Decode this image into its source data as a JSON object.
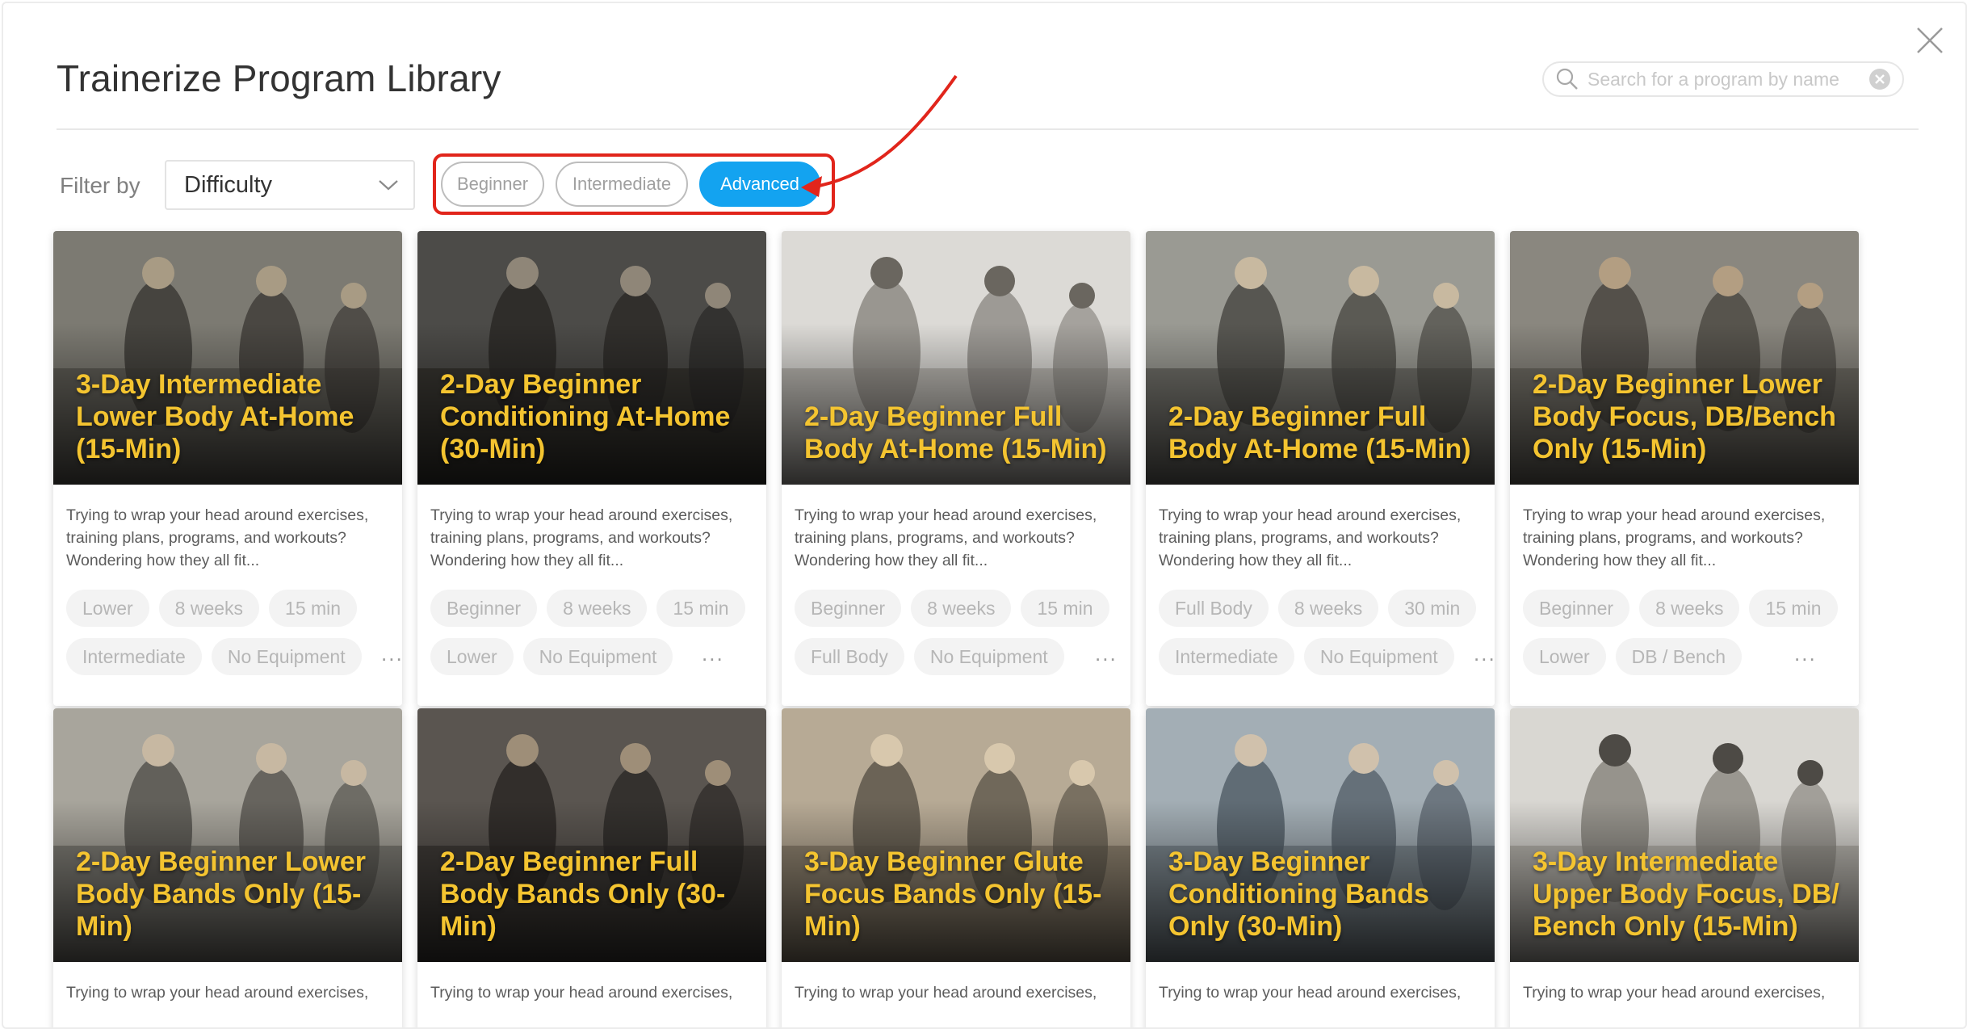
{
  "header": {
    "title": "Trainerize Program Library",
    "search_placeholder": "Search for a program by name"
  },
  "filter": {
    "label": "Filter by",
    "dropdown_value": "Difficulty",
    "options": [
      {
        "label": "Beginner",
        "selected": false
      },
      {
        "label": "Intermediate",
        "selected": false
      },
      {
        "label": "Advanced",
        "selected": true
      }
    ]
  },
  "colors": {
    "accent": "#13a3f0",
    "highlight": "#e1251b",
    "card_title": "#f4c430"
  },
  "cards": [
    {
      "title": "3-Day Intermediate Lower Body At-Home (15-Min)",
      "description": "Trying to wrap your head around exercises, training plans, programs, and workouts? Wondering how they all fit...",
      "tags_row1": [
        "Lower",
        "8 weeks",
        "15 min"
      ],
      "tags_row2": [
        "Intermediate",
        "No Equipment"
      ]
    },
    {
      "title": "2-Day Beginner Conditioning At-Home (30-Min)",
      "description": "Trying to wrap your head around exercises, training plans, programs, and workouts? Wondering how they all fit...",
      "tags_row1": [
        "Beginner",
        "8 weeks",
        "15 min"
      ],
      "tags_row2": [
        "Lower",
        "No Equipment"
      ]
    },
    {
      "title": "2-Day Beginner Full Body At-Home (15-Min)",
      "description": "Trying to wrap your head around exercises, training plans, programs, and workouts? Wondering how they all fit...",
      "tags_row1": [
        "Beginner",
        "8 weeks",
        "15 min"
      ],
      "tags_row2": [
        "Full Body",
        "No Equipment"
      ]
    },
    {
      "title": "2-Day Beginner Full Body At-Home (15-Min)",
      "description": "Trying to wrap your head around exercises, training plans, programs, and workouts? Wondering how they all fit...",
      "tags_row1": [
        "Full Body",
        "8 weeks",
        "30 min"
      ],
      "tags_row2": [
        "Intermediate",
        "No Equipment"
      ]
    },
    {
      "title": "2-Day Beginner Lower Body Focus, DB/Bench Only (15-Min)",
      "description": "Trying to wrap your head around exercises, training plans, programs, and workouts? Wondering how they all fit...",
      "tags_row1": [
        "Beginner",
        "8 weeks",
        "15 min"
      ],
      "tags_row2": [
        "Lower",
        "DB / Bench"
      ]
    },
    {
      "title": "2-Day Beginner Lower Body Bands Only (15-Min)",
      "description": "Trying to wrap your head around exercises,"
    },
    {
      "title": "2-Day Beginner Full Body Bands Only (30-Min)",
      "description": "Trying to wrap your head around exercises,"
    },
    {
      "title": "3-Day Beginner Glute Focus Bands Only (15-Min)",
      "description": "Trying to wrap your head around exercises,"
    },
    {
      "title": "3-Day Beginner Conditioning Bands Only (30-Min)",
      "description": "Trying to wrap your head around exercises,"
    },
    {
      "title": "3-Day Intermediate Upper Body Focus, DB/ Bench Only (15-Min)",
      "description": "Trying to wrap your head around exercises,"
    }
  ],
  "more_label": "..."
}
